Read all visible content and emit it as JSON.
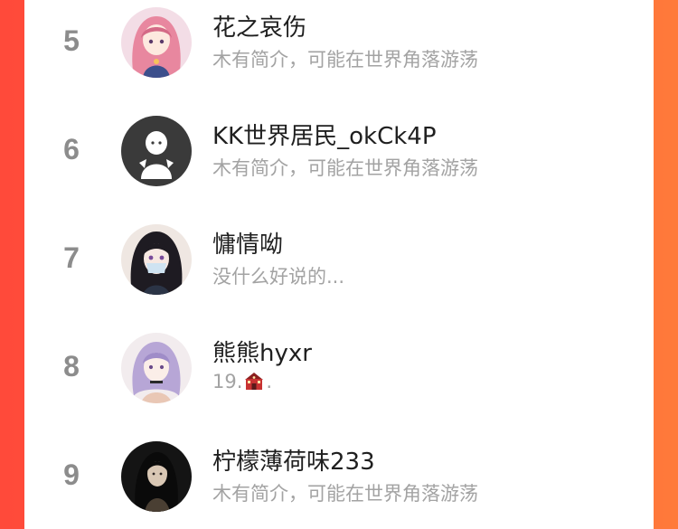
{
  "rows": [
    {
      "rank": "5",
      "name": "花之哀伤",
      "bio": "木有简介，可能在世界角落游荡",
      "avatar": "anime-girl-pink-hair-avatar"
    },
    {
      "rank": "6",
      "name": "KK世界居民_okCk4P",
      "bio": "木有简介，可能在世界角落游荡",
      "avatar": "default-ghost-avatar"
    },
    {
      "rank": "7",
      "name": "慵情呦",
      "bio": "没什么好说的...",
      "avatar": "anime-girl-mask-avatar"
    },
    {
      "rank": "8",
      "name": "熊熊hyxr",
      "bio_prefix": "19.",
      "bio_suffix": ".",
      "bio_emoji": "school-emoji",
      "avatar": "anime-girl-purple-hair-avatar"
    },
    {
      "rank": "9",
      "name": "柠檬薄荷味233",
      "bio": "木有简介，可能在世界角落游荡",
      "avatar": "dark-photo-girl-avatar"
    }
  ],
  "colors": {
    "background_left": "#ff4a3a",
    "background_right": "#ff7a3a",
    "rank": "#8c8c8c",
    "name": "#1f1f1f",
    "bio": "#a3a3a3"
  }
}
